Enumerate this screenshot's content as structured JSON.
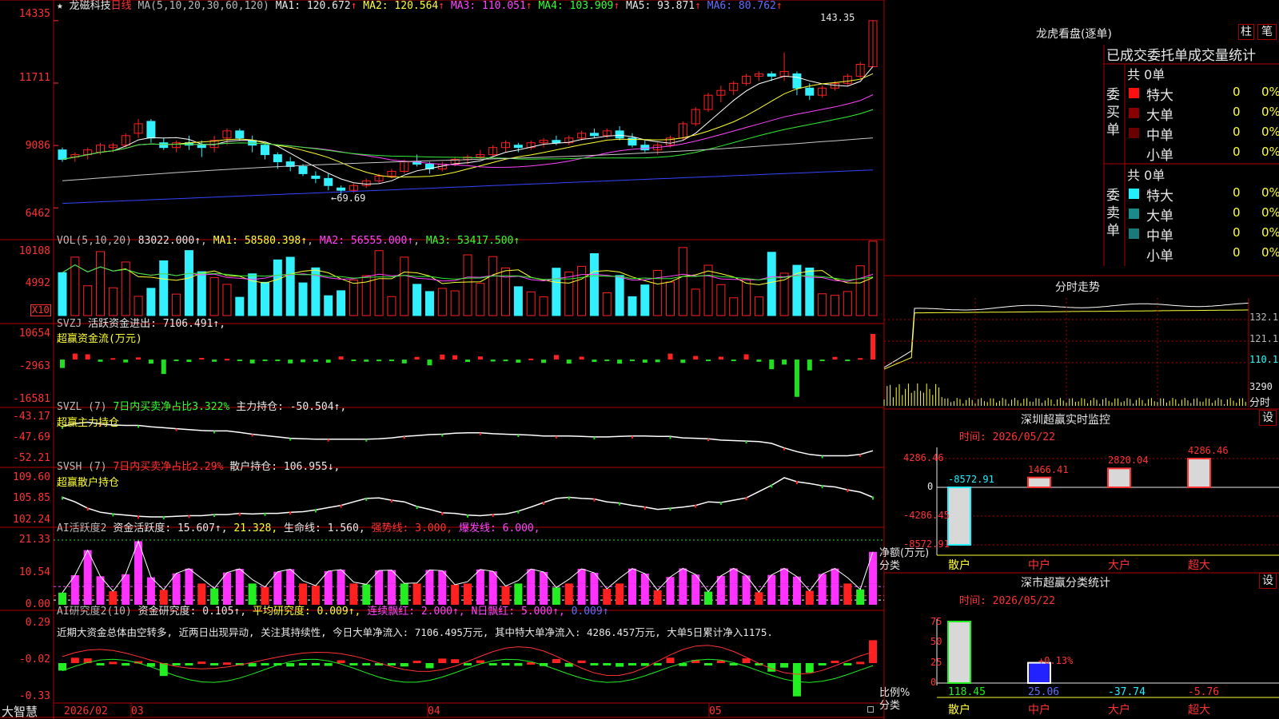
{
  "stock": {
    "name": "龙磁科技",
    "period": "日线",
    "marker": "★"
  },
  "colors": {
    "up": "#ff2020",
    "down": "#33f0ff",
    "frame": "#b00000",
    "ma1": "#ffffff",
    "ma2": "#ffff33",
    "ma3": "#ff44ff",
    "ma4": "#33ee33",
    "ma5": "#c8c8c8",
    "ma6": "#3344ff"
  },
  "price": {
    "label": "MA(5,10,20,30,60,120)",
    "ma1": "MA1: 120.672",
    "ma2": "MA2: 120.564",
    "ma3": "MA3: 110.051",
    "ma4": "MA4: 103.909",
    "ma5": "MA5: 93.871",
    "ma6": "MA6: 80.762",
    "arrow_up": "↑",
    "y_ticks": [
      "14335",
      "11711",
      "9086",
      "6462"
    ],
    "high_label": "143.35",
    "low_label": "69.69",
    "low_arrow": "←"
  },
  "vol": {
    "label": "VOL(5,10,20)",
    "value": "83022.000↑",
    "ma1": "MA1: 58580.398↑",
    "ma2": "MA2: 56555.000↑",
    "ma3": "MA3: 53417.500↑",
    "y_ticks": [
      "10108",
      "4992"
    ],
    "unit": "X10"
  },
  "svzj": {
    "label": "SVZJ",
    "text": "活跃资金进出: 7106.491↑,",
    "sub": "超赢资金流(万元)",
    "y_ticks": [
      "10654",
      "-2963",
      "-16581"
    ]
  },
  "svzl": {
    "label": "SVZL (7)",
    "ratio": "7日内买卖净占比3.322%",
    "text": "主力持仓: -50.504↑,",
    "sub": "超赢主力持仓",
    "y_ticks": [
      "-43.17",
      "-47.69",
      "-52.21"
    ]
  },
  "svsh": {
    "label": "SVSH (7)",
    "ratio": "7日内买卖净占比2.29%",
    "text": "散户持仓: 106.955↓,",
    "sub": "超赢散户持仓",
    "y_ticks": [
      "109.60",
      "105.85",
      "102.24"
    ]
  },
  "ai1": {
    "label": "AI活跃度2",
    "text": "资金活跃度: 15.607↑,",
    "val2": "21.328,",
    "life": "生命线: 1.560,",
    "strong": "强势线: 3.000,",
    "burst": "爆发线: 6.000,",
    "y_ticks": [
      "21.33",
      "10.54",
      "0.00"
    ]
  },
  "ai2": {
    "label": "AI研究度2(10)",
    "text": "资金研究度: 0.105↑,",
    "avg": "平均研究度: 0.009↑,",
    "streak": "连续飘红: 2.000↑,",
    "nday": "N日飘红: 5.000↑,",
    "last": "0.009↑",
    "comment": "近期大资金总体由空转多, 近两日出现异动, 关注其持续性, 今日大单净流入: 7106.495万元, 其中特大单净流入: 4286.457万元, 大单5日累计净入1175.",
    "y_ticks": [
      "0.29",
      "-0.02",
      "-0.33"
    ]
  },
  "bottom_axis": {
    "brand": "大智慧",
    "dates": [
      "2026/02",
      "03",
      "04",
      "05"
    ]
  },
  "side": {
    "title": "龙虎看盘(逐单)",
    "btn_bar": "柱",
    "btn_tick": "笔",
    "tabs": [
      "已成交",
      "委托单",
      "成交量统计"
    ],
    "buy": {
      "label": "委买单",
      "total": "共 0单",
      "rows": [
        {
          "name": "特大",
          "v": "0",
          "p": "0%"
        },
        {
          "name": "大单",
          "v": "0",
          "p": "0%"
        },
        {
          "name": "中单",
          "v": "0",
          "p": "0%"
        },
        {
          "name": "小单",
          "v": "0",
          "p": "0%"
        }
      ]
    },
    "sell": {
      "label": "委卖单",
      "total": "共 0单",
      "rows": [
        {
          "name": "特大",
          "v": "0",
          "p": "0%"
        },
        {
          "name": "大单",
          "v": "0",
          "p": "0%"
        },
        {
          "name": "中单",
          "v": "0",
          "p": "0%"
        },
        {
          "name": "小单",
          "v": "0",
          "p": "0%"
        }
      ]
    },
    "intraday": {
      "title": "分时走势",
      "ticks": [
        "132.1",
        "121.1",
        "110.1"
      ],
      "vol_tick": "3290",
      "unit": "分时"
    },
    "monitor": {
      "title": "深圳超赢实时监控",
      "btn": "设",
      "time": "时间: 2026/05/22",
      "y_ticks": [
        "4286.46",
        "0",
        "-4286.45",
        "-8572.91"
      ],
      "axis_label": "净额(万元)",
      "cat_label": "分类",
      "bars": [
        {
          "name": "散户",
          "val": "-8572.91",
          "v": -8572.91
        },
        {
          "name": "中户",
          "val": "1466.41",
          "v": 1466.41
        },
        {
          "name": "大户",
          "val": "2820.04",
          "v": 2820.04
        },
        {
          "name": "超大",
          "val": "4286.46",
          "v": 4286.46
        }
      ]
    },
    "class_stat": {
      "title": "深市超赢分类统计",
      "btn": "设",
      "time": "时间: 2026/05/22",
      "y_ticks": [
        "75",
        "50",
        "25",
        "0"
      ],
      "axis_label": "比例%",
      "cat_label": "分类",
      "note": "+0.13%",
      "bars": [
        {
          "name": "散户",
          "val": "118.45",
          "v": 118.45
        },
        {
          "name": "中户",
          "val": "25.06",
          "v": 25.06
        },
        {
          "name": "大户",
          "val": "-37.74",
          "v": -37.74
        },
        {
          "name": "超大",
          "val": "-5.76",
          "v": -5.76
        }
      ]
    }
  },
  "chart_data": {
    "type": "candlestick",
    "candles": [
      [
        89,
        90,
        84,
        85
      ],
      [
        86,
        88,
        84,
        87
      ],
      [
        87,
        90,
        85,
        89
      ],
      [
        88,
        92,
        87,
        91
      ],
      [
        90,
        92,
        88,
        91
      ],
      [
        91,
        96,
        90,
        95
      ],
      [
        96,
        102,
        94,
        100
      ],
      [
        101,
        102,
        92,
        94
      ],
      [
        92,
        94,
        89,
        90
      ],
      [
        90,
        93,
        88,
        92
      ],
      [
        92,
        95,
        89,
        91
      ],
      [
        91,
        93,
        86,
        90
      ],
      [
        90,
        95,
        88,
        93
      ],
      [
        94,
        98,
        91,
        97
      ],
      [
        97,
        98,
        93,
        94
      ],
      [
        93,
        95,
        88,
        91
      ],
      [
        91,
        92,
        85,
        87
      ],
      [
        87,
        88,
        81,
        84
      ],
      [
        84,
        86,
        80,
        82
      ],
      [
        82,
        83,
        78,
        79
      ],
      [
        78,
        80,
        75,
        77
      ],
      [
        77,
        79,
        72,
        74
      ],
      [
        73,
        74,
        69.69,
        72
      ],
      [
        72,
        75,
        71,
        74
      ],
      [
        74,
        77,
        73,
        76
      ],
      [
        76,
        79,
        75,
        78
      ],
      [
        78,
        81,
        77,
        80
      ],
      [
        80,
        85,
        79,
        84
      ],
      [
        84,
        87,
        82,
        83
      ],
      [
        83,
        84,
        79,
        81
      ],
      [
        81,
        84,
        80,
        83
      ],
      [
        83,
        86,
        82,
        85
      ],
      [
        85,
        87,
        83,
        86
      ],
      [
        86,
        89,
        85,
        87
      ],
      [
        87,
        91,
        86,
        90
      ],
      [
        90,
        93,
        88,
        92
      ],
      [
        91,
        92,
        88,
        90
      ],
      [
        90,
        93,
        89,
        92
      ],
      [
        92,
        94,
        90,
        93
      ],
      [
        93,
        95,
        91,
        92
      ],
      [
        92,
        95,
        91,
        94
      ],
      [
        94,
        97,
        93,
        96
      ],
      [
        96,
        98,
        94,
        95
      ],
      [
        95,
        98,
        94,
        97
      ],
      [
        97,
        99,
        93,
        94
      ],
      [
        94,
        96,
        90,
        91
      ],
      [
        91,
        93,
        88,
        89
      ],
      [
        89,
        92,
        87,
        91
      ],
      [
        91,
        95,
        90,
        94
      ],
      [
        94,
        101,
        93,
        100
      ],
      [
        100,
        107,
        99,
        106
      ],
      [
        106,
        113,
        105,
        112
      ],
      [
        112,
        116,
        109,
        114
      ],
      [
        114,
        118,
        112,
        117
      ],
      [
        117,
        121,
        116,
        120
      ],
      [
        120,
        122,
        118,
        121
      ],
      [
        121,
        122,
        118,
        120
      ],
      [
        120,
        130,
        118,
        122
      ],
      [
        121,
        122,
        112,
        115
      ],
      [
        115,
        117,
        110,
        112
      ],
      [
        112,
        116,
        111,
        115
      ],
      [
        115,
        118,
        114,
        117
      ],
      [
        117,
        121,
        116,
        120
      ],
      [
        120,
        126,
        119,
        125
      ],
      [
        124,
        143.35,
        124,
        143.35
      ]
    ],
    "svzj": [
      -3500,
      2500,
      2200,
      -900,
      600,
      -1200,
      900,
      -1700,
      -6000,
      -300,
      -1000,
      700,
      -900,
      300,
      -300,
      -1600,
      -500,
      -400,
      -1600,
      -1100,
      -900,
      -1300,
      1300,
      -300,
      -900,
      -700,
      -400,
      -1600,
      1100,
      -2400,
      2100,
      1800,
      -1000,
      1300,
      -800,
      -700,
      -1300,
      400,
      -1400,
      1900,
      -1700,
      1200,
      -1000,
      -400,
      -1700,
      -500,
      -1300,
      -1100,
      2500,
      -1400,
      1500,
      -600,
      1200,
      -600,
      2200,
      -900,
      -4000,
      -2100,
      -15500,
      -4500,
      -600,
      1100,
      -500,
      600,
      10654
    ],
    "svzl": [
      -45.2,
      -44.6,
      -44.3,
      -44.7,
      -44.9,
      -45.0,
      -45.0,
      -45.3,
      -45.5,
      -45.7,
      -45.9,
      -46.1,
      -46.2,
      -46.2,
      -46.5,
      -46.9,
      -47.2,
      -47.5,
      -47.8,
      -47.9,
      -48.0,
      -48.0,
      -48.0,
      -48.0,
      -48.0,
      -47.9,
      -47.7,
      -47.4,
      -47.2,
      -47.0,
      -46.9,
      -46.7,
      -46.6,
      -46.6,
      -46.8,
      -46.9,
      -47.0,
      -47.1,
      -47.3,
      -47.3,
      -47.3,
      -47.4,
      -47.5,
      -47.5,
      -47.4,
      -47.3,
      -47.3,
      -47.4,
      -47.4,
      -47.7,
      -47.8,
      -47.9,
      -48.2,
      -48.3,
      -48.4,
      -48.5,
      -48.9,
      -49.9,
      -50.7,
      -51.3,
      -51.6,
      -51.6,
      -51.6,
      -51.3,
      -50.5
    ],
    "svsh": [
      106.2,
      105.4,
      104.3,
      103.6,
      103.3,
      103.1,
      102.9,
      102.8,
      102.8,
      102.9,
      103.0,
      103.0,
      103.2,
      103.2,
      103.4,
      103.3,
      103.4,
      103.4,
      103.6,
      103.7,
      104.0,
      104.4,
      104.8,
      105.4,
      106.0,
      106.1,
      105.7,
      105.4,
      104.6,
      104.1,
      103.5,
      103.4,
      103.1,
      103.0,
      103.2,
      103.3,
      103.8,
      104.5,
      105.3,
      106.0,
      106.2,
      106.0,
      105.9,
      105.4,
      105.2,
      104.8,
      104.5,
      104.1,
      104.3,
      104.5,
      104.8,
      105.4,
      105.3,
      105.7,
      106.1,
      107.2,
      108.3,
      109.6,
      108.9,
      108.6,
      108.2,
      108.0,
      107.5,
      107.1,
      106.2
    ]
  }
}
